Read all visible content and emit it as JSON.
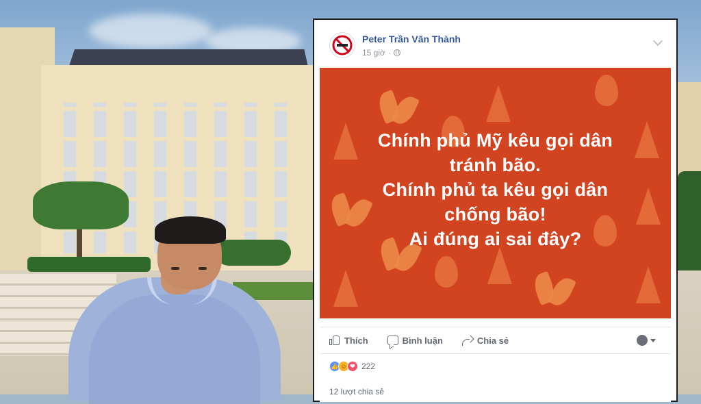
{
  "post": {
    "author": "Peter Trần Văn Thành",
    "time": "15 giờ",
    "avatar_text": "PCA-NOHA",
    "image_text": [
      "Chính phủ Mỹ kêu gọi dân",
      "tránh bão.",
      "Chính phủ ta kêu gọi dân",
      "chống bão!",
      "Ai đúng ai sai đây?"
    ],
    "actions": {
      "like": "Thích",
      "comment": "Bình luận",
      "share": "Chia sẻ"
    },
    "reactions": {
      "icons": [
        "like-icon",
        "haha-icon",
        "love-icon"
      ],
      "count": "222"
    },
    "shares": "12 lượt chia sẻ"
  },
  "colors": {
    "accent": "#365899",
    "image_background": "#d2431f",
    "image_text": "#ffffff"
  }
}
